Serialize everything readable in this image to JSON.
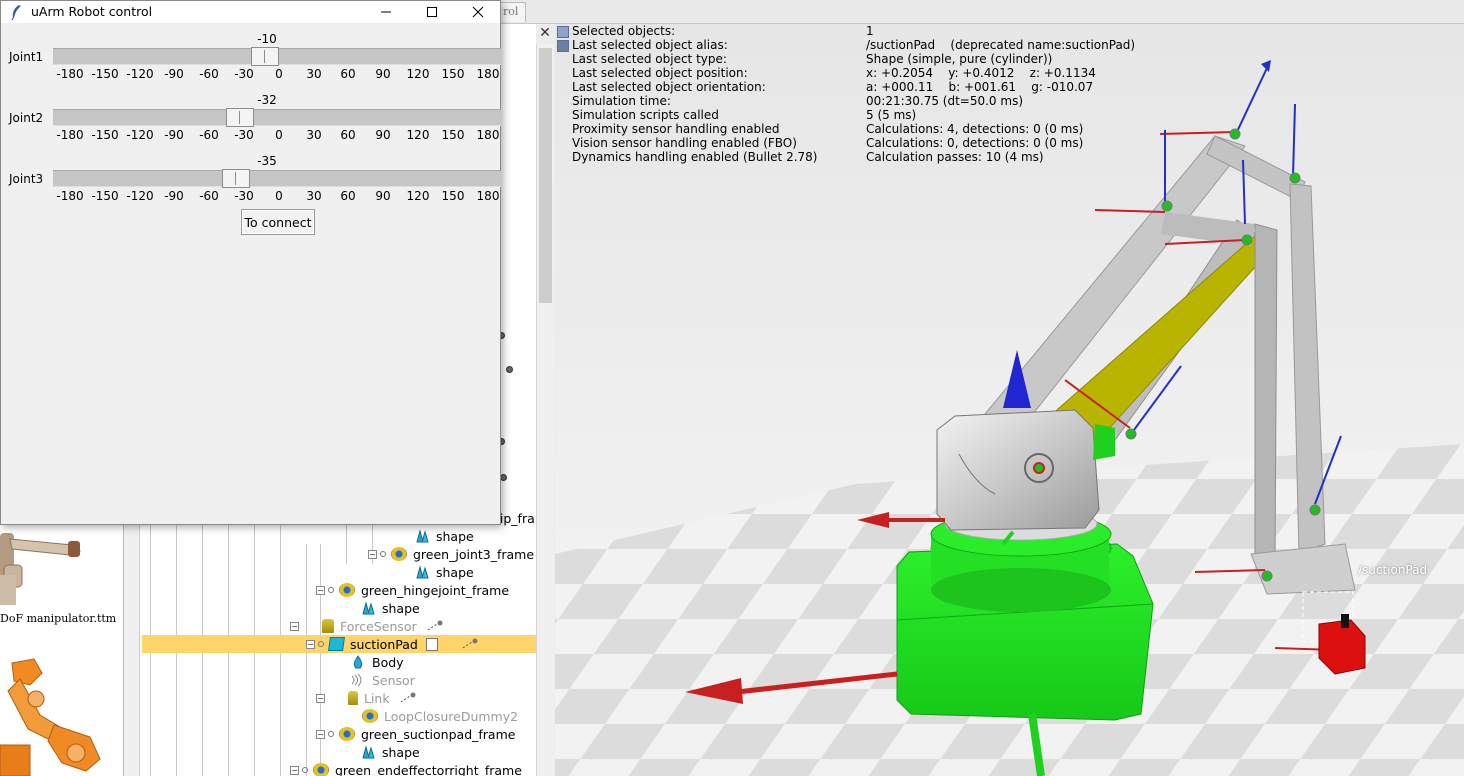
{
  "dialog": {
    "title": "uArm Robot control",
    "connect_label": "To connect",
    "ticks": [
      "-180",
      "-150",
      "-120",
      "-90",
      "-60",
      "-30",
      "0",
      "30",
      "60",
      "90",
      "120",
      "150",
      "180"
    ],
    "joints": [
      {
        "label": "Joint1",
        "value": "-10"
      },
      {
        "label": "Joint2",
        "value": "-32"
      },
      {
        "label": "Joint3",
        "value": "-35"
      }
    ]
  },
  "background": {
    "tab_fragment": "rol",
    "model_caption": "DoF manipulator.ttm",
    "viewport_tag": "/suctionPad"
  },
  "hierarchy": {
    "rows": [
      {
        "label": "tip_fra",
        "dim": false
      },
      {
        "label": "shape",
        "dim": false
      },
      {
        "label": "green_joint3_frame",
        "dim": false
      },
      {
        "label": "shape",
        "dim": false
      },
      {
        "label": "green_hingejoint_frame",
        "dim": false
      },
      {
        "label": "shape",
        "dim": false
      },
      {
        "label": "ForceSensor",
        "dim": true
      },
      {
        "label": "suctionPad",
        "dim": false
      },
      {
        "label": "Body",
        "dim": false
      },
      {
        "label": "Sensor",
        "dim": true
      },
      {
        "label": "Link",
        "dim": true
      },
      {
        "label": "LoopClosureDummy2",
        "dim": true
      },
      {
        "label": "green_suctionpad_frame",
        "dim": false
      },
      {
        "label": "shape",
        "dim": false
      },
      {
        "label": "green_endeffectorright_frame",
        "dim": false
      }
    ]
  },
  "info": {
    "labels": [
      "Selected objects:",
      "Last selected object alias:",
      "Last selected object type:",
      "Last selected object position:",
      "Last selected object orientation:",
      "Simulation time:",
      "Simulation scripts called",
      "Proximity sensor handling enabled",
      "Vision sensor handling enabled (FBO)",
      "Dynamics handling enabled (Bullet 2.78)"
    ],
    "values": [
      "1",
      "/suctionPad    (deprecated name:suctionPad)",
      "Shape (simple, pure (cylinder))",
      "x: +0.2054    y: +0.4012    z: +0.1134",
      "a: +000.11    b: +001.61    g: -010.07",
      "00:21:30.75 (dt=50.0 ms)",
      "5 (5 ms)",
      "Calculations: 4, detections: 0 (0 ms)",
      "Calculations: 0, detections: 0 (0 ms)",
      "Calculation passes: 10 (4 ms)"
    ]
  },
  "colors": {
    "selection_highlight": "#ffd56b",
    "robot_green": "#21e021",
    "arm_yellow": "#b8b400",
    "axis_red": "#c82020",
    "axis_blue": "#2030c8"
  }
}
